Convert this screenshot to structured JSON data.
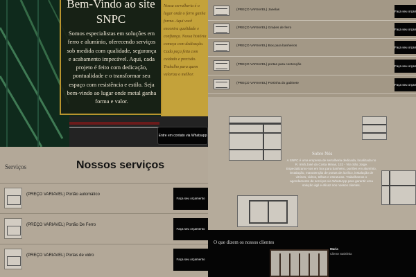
{
  "hero": {
    "title_line1": "Bem-Vindo ao site",
    "title_line2": "SNPC",
    "description": "Somos especialistas em soluções em ferro e alumínio, oferecendo serviços sob medida com qualidade, segurança e acabamento impecável. Aqui, cada projeto é feito com dedicação, pontualidade e o transformar seu espaço com resistência e estilo. Seja bem-vindo ao lugar onde metal ganha forma e valor.",
    "background_script": "Nossa serralheria é o lugar onde o ferro ganha forma. Aqui você encontra qualidade e confiança. Nossa história começa com dedicação. Cada peça feita com cuidado e precisão. Trabalho para quem valoriza o melhor.",
    "contact_button": "Entre em contato via Whatsapp"
  },
  "services": {
    "label": "Serviços",
    "title": "Nossos serviços",
    "items": [
      {
        "name": "(PREÇO VARIAVEL) Portão automático",
        "button": "Faça seu orçamento"
      },
      {
        "name": "(PREÇO VARIAVEL) Portão De Ferro",
        "button": "Faça seu orçamento"
      },
      {
        "name": "(PREÇO VARIAVEL) Portas de vidro",
        "button": "Faça seu orçamento"
      }
    ]
  },
  "products": {
    "items": [
      {
        "name": "(PREÇO VARIAVEL) Janelas",
        "button": "Faça seu orçamento"
      },
      {
        "name": "(PREÇO VARIAVEL) Grades de ferro",
        "button": "Faça seu orçamento"
      },
      {
        "name": "(PREÇO VARIAVEL) Box para banheiros",
        "button": "Faça seu orçamento"
      },
      {
        "name": "(PREÇO VARIAVEL) portas para contenção",
        "button": "Faça seu orçamento"
      },
      {
        "name": "(PREÇO VARIAVEL) Portinha do gabinete",
        "button": "Faça seu orçamento"
      }
    ]
  },
  "about": {
    "title": "Sobre Nós",
    "text": "A SNPC é uma empresa de serralheria dedicada, localizada no R. Irmã José da Costa Minas, 132 - Vila São Jorge. Especializamo-nos em box para banheiro, portões em alumínio, instalação, manutenção de portas de ácrilico, instalação de vitrines, vidros, telhas e estruturas. Trabalhamos o agendamento de serviços via WhatsApp para garantir uma solução ágil e eficaz nos nossos clientes."
  },
  "testimonials": {
    "title": "O que dizem os nossos clientes",
    "name": "Maria",
    "role": "Cliente Satisfeita"
  },
  "colors": {
    "gold": "#b8942e",
    "dark_green": "#12281c",
    "button_black": "#050505",
    "beige": "#b3a898"
  }
}
